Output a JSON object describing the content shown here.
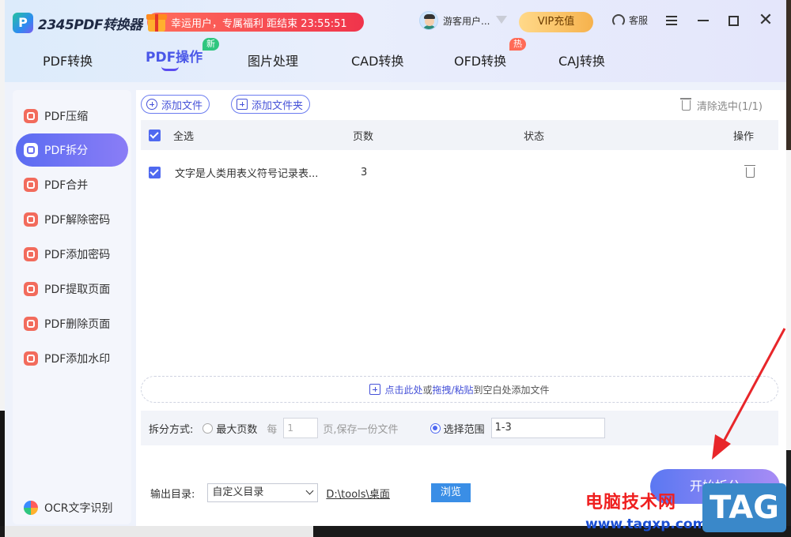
{
  "app": {
    "logo_text": "2345PDF转换器",
    "promo": "幸运用户，专属福利 距结束 23:55:51",
    "user_name": "游客用户...",
    "vip_label": "VIP充值",
    "service_label": "客服"
  },
  "tabs": [
    {
      "label": "PDF转换"
    },
    {
      "label": "PDF操作"
    },
    {
      "label": "图片处理"
    },
    {
      "label": "CAD转换"
    },
    {
      "label": "OFD转换"
    },
    {
      "label": "CAJ转换"
    }
  ],
  "badges": {
    "new": "新",
    "hot": "热"
  },
  "sidebar": {
    "items": [
      {
        "label": "PDF压缩"
      },
      {
        "label": "PDF拆分"
      },
      {
        "label": "PDF合并"
      },
      {
        "label": "PDF解除密码"
      },
      {
        "label": "PDF添加密码"
      },
      {
        "label": "PDF提取页面"
      },
      {
        "label": "PDF删除页面"
      },
      {
        "label": "PDF添加水印"
      }
    ],
    "ocr_label": "OCR文字识别"
  },
  "toolbar": {
    "add_file": "添加文件",
    "add_folder": "添加文件夹",
    "clear_selected": "清除选中(1/1)"
  },
  "table": {
    "headers": {
      "select_all": "全选",
      "pages": "页数",
      "status": "状态",
      "actions": "操作"
    },
    "rows": [
      {
        "name": "文字是人类用表义符号记录表...",
        "pages": "3",
        "status": ""
      }
    ]
  },
  "drop_zone": {
    "part1": "点击此处",
    "part2": "或",
    "part3": "拖拽/粘贴",
    "part4": "到空白处添加文件"
  },
  "split": {
    "label": "拆分方式:",
    "option_max_pages": "最大页数",
    "every": "每",
    "pages_value": "1",
    "pages_suffix": "页,保存一份文件",
    "option_range": "选择范围",
    "range_value": "1-3"
  },
  "output": {
    "label": "输出目录:",
    "select_value": "自定义目录",
    "path": "D:\\tools\\桌面",
    "browse": "浏览"
  },
  "start_button": "开始拆分",
  "watermark": {
    "text": "电脑技术网",
    "url": "www.tagxp.com",
    "tag": "TAG"
  },
  "colors": {
    "accent": "#4f69f0",
    "annotation_arrow": "#e8262a"
  }
}
